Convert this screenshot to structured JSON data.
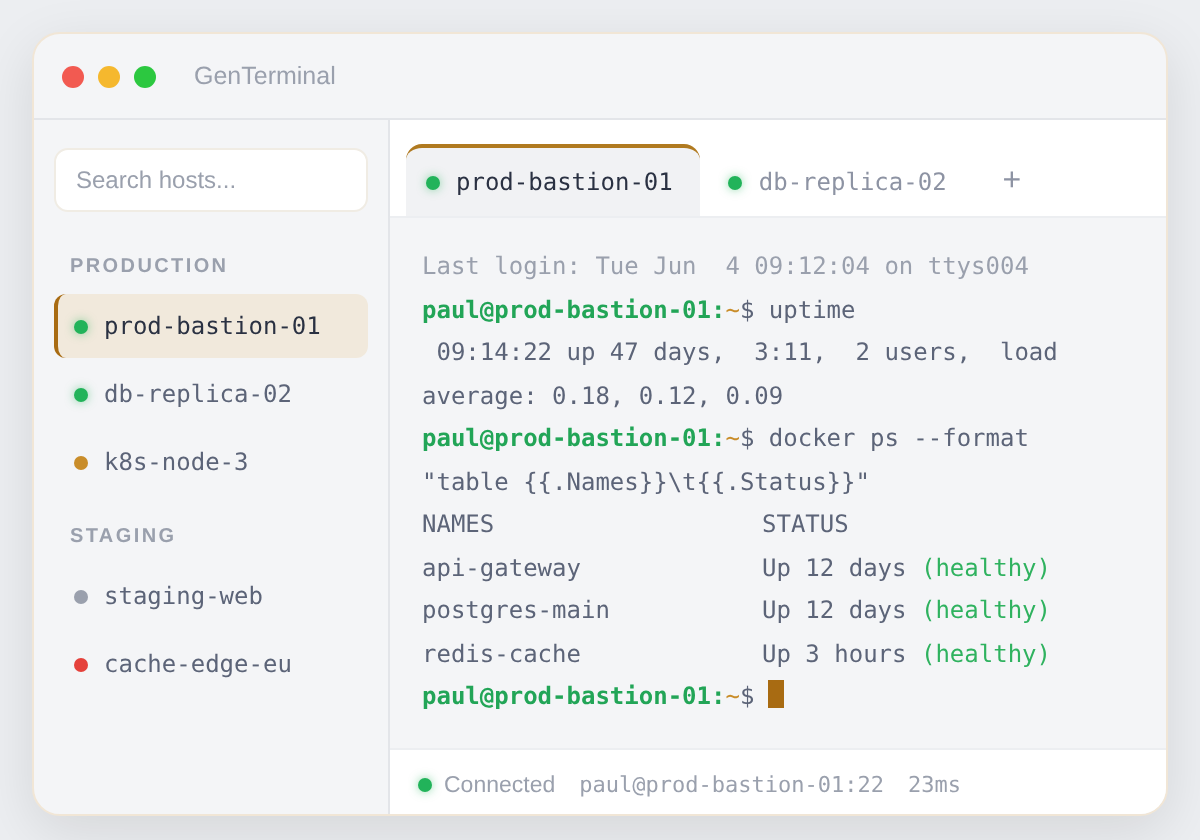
{
  "window": {
    "title": "GenTerminal"
  },
  "sidebar": {
    "search": {
      "placeholder": "Search hosts..."
    },
    "groups": [
      {
        "label": "PRODUCTION",
        "hosts": [
          {
            "name": "prod-bastion-01",
            "color": "#22b35a",
            "selected": true
          },
          {
            "name": "db-replica-02",
            "color": "#22b35a",
            "selected": false
          },
          {
            "name": "k8s-node-3",
            "color": "#c98d2a",
            "selected": false
          }
        ]
      },
      {
        "label": "STAGING",
        "hosts": [
          {
            "name": "staging-web",
            "color": "#9aa0ad",
            "selected": false
          },
          {
            "name": "cache-edge-eu",
            "color": "#e5413b",
            "selected": false
          }
        ]
      }
    ]
  },
  "tabs": [
    {
      "label": "prod-bastion-01",
      "selected": true
    },
    {
      "label": "db-replica-02",
      "selected": false
    }
  ],
  "new_tab": "+",
  "terminal": {
    "lines": [
      {
        "kind": "info",
        "text": "Last login: Tue Jun  4 09:12:04 on ttys004"
      },
      {
        "kind": "prompt",
        "user": "paul@prod-bastion-01:",
        "path": "~",
        "sign": "$",
        "command": "uptime",
        "cursor": false
      },
      {
        "kind": "output",
        "text": " 09:14:22 up 47 days,  3:11,  2 users,  load"
      },
      {
        "kind": "output",
        "text": "average: 0.18, 0.12, 0.09"
      },
      {
        "kind": "prompt",
        "user": "paul@prod-bastion-01:",
        "path": "~",
        "sign": "$",
        "command": "docker ps --format",
        "cursor": false
      },
      {
        "kind": "output",
        "text": "\"table {{.Names}}\\t{{.Status}}\""
      },
      {
        "kind": "row",
        "name": "NAMES",
        "status": "STATUS"
      },
      {
        "kind": "row",
        "name": "api-gateway",
        "status": "Up 12 days",
        "health": "(healthy)"
      },
      {
        "kind": "row",
        "name": "postgres-main",
        "status": "Up 12 days",
        "health": "(healthy)"
      },
      {
        "kind": "row",
        "name": "redis-cache",
        "status": "Up 3 hours",
        "health": "(healthy)"
      },
      {
        "kind": "prompt",
        "user": "paul@prod-bastion-01:",
        "path": "~",
        "sign": "$",
        "cursor": true
      }
    ]
  },
  "status_bar": {
    "connection": "Connected",
    "connected": true,
    "target": "paul@prod-bastion-01:22",
    "latency": "23ms"
  }
}
